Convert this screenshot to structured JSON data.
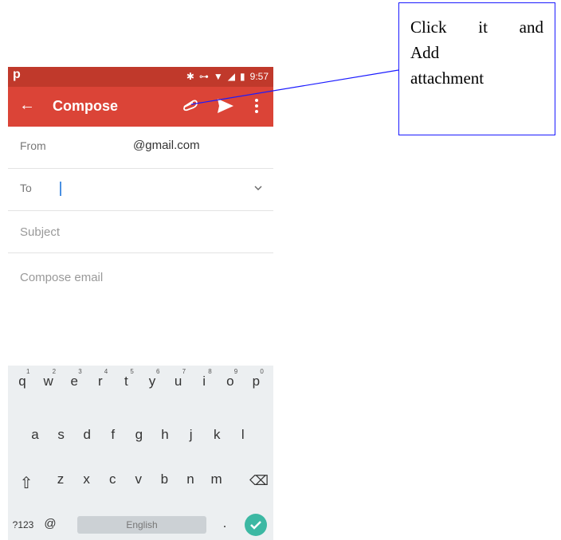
{
  "status_bar": {
    "app_letter": "p",
    "time": "9:57"
  },
  "app_bar": {
    "title": "Compose"
  },
  "compose": {
    "from_label": "From",
    "from_value": "@gmail.com",
    "to_label": "To",
    "subject_placeholder": "Subject",
    "body_placeholder": "Compose email"
  },
  "keyboard": {
    "row1": [
      "q",
      "w",
      "e",
      "r",
      "t",
      "y",
      "u",
      "i",
      "o",
      "p"
    ],
    "row1_numbers": [
      "1",
      "2",
      "3",
      "4",
      "5",
      "6",
      "7",
      "8",
      "9",
      "0"
    ],
    "row2": [
      "a",
      "s",
      "d",
      "f",
      "g",
      "h",
      "j",
      "k",
      "l"
    ],
    "row3": [
      "z",
      "x",
      "c",
      "v",
      "b",
      "n",
      "m"
    ],
    "symbols_key": "?123",
    "at_key": "@",
    "space_label": "English",
    "period_key": "."
  },
  "callout": {
    "line1_words": [
      "Click",
      "it",
      "and"
    ],
    "line2": "Add",
    "line3": "attachment",
    "border_color": "#1a1aff"
  },
  "colors": {
    "status_bar": "#c0392b",
    "app_bar": "#db4437",
    "accent": "#3cb8a3"
  }
}
